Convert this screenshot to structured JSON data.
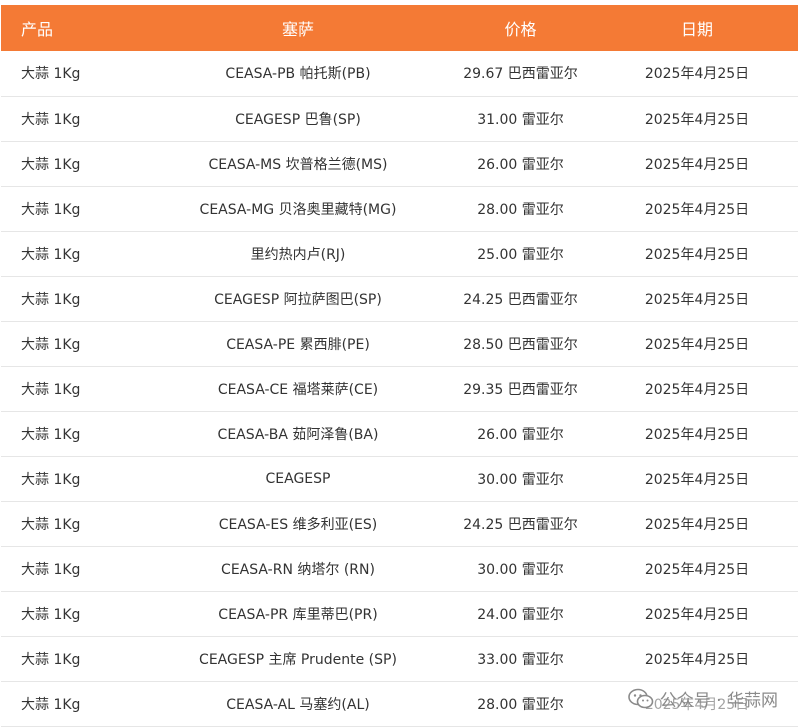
{
  "table": {
    "headers": [
      "产品",
      "塞萨",
      "价格",
      "日期"
    ],
    "rows": [
      [
        "大蒜 1Kg",
        "CEASA-PB 帕托斯(PB)",
        "29.67 巴西雷亚尔",
        "2025年4月25日"
      ],
      [
        "大蒜 1Kg",
        "CEAGESP 巴鲁(SP)",
        "31.00 雷亚尔",
        "2025年4月25日"
      ],
      [
        "大蒜 1Kg",
        "CEASA-MS 坎普格兰德(MS)",
        "26.00 雷亚尔",
        "2025年4月25日"
      ],
      [
        "大蒜 1Kg",
        "CEASA-MG 贝洛奥里藏特(MG)",
        "28.00 雷亚尔",
        "2025年4月25日"
      ],
      [
        "大蒜 1Kg",
        "里约热内卢(RJ)",
        "25.00 雷亚尔",
        "2025年4月25日"
      ],
      [
        "大蒜 1Kg",
        "CEAGESP 阿拉萨图巴(SP)",
        "24.25 巴西雷亚尔",
        "2025年4月25日"
      ],
      [
        "大蒜 1Kg",
        "CEASA-PE 累西腓(PE)",
        "28.50 巴西雷亚尔",
        "2025年4月25日"
      ],
      [
        "大蒜 1Kg",
        "CEASA-CE 福塔莱萨(CE)",
        "29.35 巴西雷亚尔",
        "2025年4月25日"
      ],
      [
        "大蒜 1Kg",
        "CEASA-BA 茹阿泽鲁(BA)",
        "26.00 雷亚尔",
        "2025年4月25日"
      ],
      [
        "大蒜 1Kg",
        "CEAGESP",
        "30.00 雷亚尔",
        "2025年4月25日"
      ],
      [
        "大蒜 1Kg",
        "CEASA-ES 维多利亚(ES)",
        "24.25 巴西雷亚尔",
        "2025年4月25日"
      ],
      [
        "大蒜 1Kg",
        "CEASA-RN 纳塔尔 (RN)",
        "30.00 雷亚尔",
        "2025年4月25日"
      ],
      [
        "大蒜 1Kg",
        "CEASA-PR 库里蒂巴(PR)",
        "24.00 雷亚尔",
        "2025年4月25日"
      ],
      [
        "大蒜 1Kg",
        "CEAGESP 主席 Prudente (SP)",
        "33.00 雷亚尔",
        "2025年4月25日"
      ],
      [
        "大蒜 1Kg",
        "CEASA-AL 马塞约(AL)",
        "28.00 雷亚尔",
        "2025年4月25日"
      ]
    ]
  },
  "watermark": {
    "text": "公众号 · 华蒜网",
    "icon": "wechat-icon"
  },
  "colors": {
    "header_bg": "#f47a35",
    "header_text": "#ffffff",
    "row_border": "#e6e6e6",
    "text": "#333333"
  }
}
